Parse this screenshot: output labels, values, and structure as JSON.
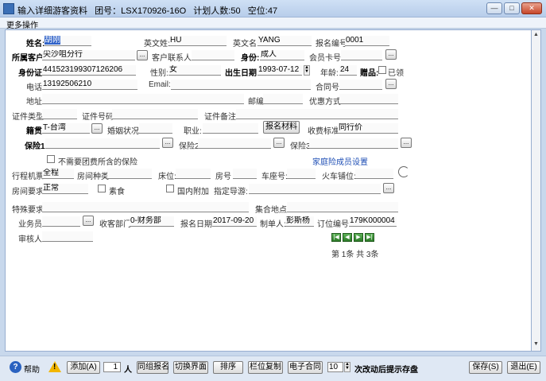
{
  "window": {
    "title": "输入详细游客资料",
    "group_label": "团号：",
    "group_no": "LSX170926-16O",
    "plan_label": "计划人数:",
    "plan_count": "50",
    "vacancy_label": "空位:",
    "vacancy_count": "47"
  },
  "menu": {
    "more_ops": "更多操作"
  },
  "form": {
    "name_label": "姓名:",
    "name_value": "胡刚",
    "en_surname_label": "英文姓:",
    "en_surname_value": "HU",
    "en_name_label": "英文名:",
    "en_name_value": "YANG",
    "reg_no_label": "报名编号:",
    "reg_no_value": "0001",
    "customer_label": "所属客户:",
    "customer_value": "尖沙咀分行",
    "contact_label": "客户联系人:",
    "contact_value": "",
    "identity_label": "身份:",
    "identity_value": "成人",
    "member_card_label": "会员卡号:",
    "member_card_value": "",
    "id_card_label": "身份证:",
    "id_card_value": "441523199307126206",
    "gender_label": "性别:",
    "gender_value": "女",
    "birth_label": "出生日期:",
    "birth_value": "1993-07-12",
    "age_label": "年龄:",
    "age_value": "24",
    "gift_label": "赠品:",
    "gift_checked_label": "已领",
    "phone_label": "电话:",
    "phone_value": "13192506210",
    "email_label": "Email:",
    "email_value": "",
    "contract_no_label": "合同号:",
    "contract_no_value": "",
    "address_label": "地址:",
    "address_value": "",
    "postcode_label": "邮编:",
    "postcode_value": "",
    "discount_label": "优惠方式:",
    "discount_value": "",
    "cert_type_label": "证件类型:",
    "cert_type_value": "",
    "cert_no_label": "证件号码:",
    "cert_no_value": "",
    "cert_note_label": "证件备注:",
    "cert_note_value": "",
    "origin_label": "籍贯:",
    "origin_value": "T-台湾",
    "marital_label": "婚姻状况:",
    "marital_value": "",
    "job_label": "职业:",
    "job_value": "",
    "reg_material_button": "报名材料",
    "fee_std_label": "收费标准:",
    "fee_std_value": "同行价",
    "insurance1_label": "保险1:",
    "insurance1_value": "",
    "insurance2_label": "保险2:",
    "insurance2_value": "",
    "insurance3_label": "保险3:",
    "insurance3_value": "",
    "no_group_insurance_label": "不需要团费所含的保险",
    "family_insurance_link": "家庭险成员设置",
    "ticket_label": "行程机票:",
    "ticket_value": "全程",
    "room_type_label": "房间种类:",
    "room_type_value": "",
    "bed_label": "床位:",
    "bed_value": "",
    "room_no_label": "房号",
    "room_no_value": "",
    "seat_no_label": "车座号:",
    "seat_no_value": "",
    "train_bed_label": "火车铺位:",
    "train_bed_value": "",
    "room_req_label": "房间要求:",
    "room_req_value": "正常",
    "vegetarian_label": "素食",
    "domestic_add_label": "国内附加",
    "guide_label": "指定导游:",
    "guide_value": "",
    "special_req_label": "特殊要求:",
    "special_req_value": "",
    "meeting_label": "集合地点:",
    "meeting_value": "",
    "salesman_label": "业务员:",
    "salesman_value": "",
    "recv_dept_label": "收客部门:",
    "recv_dept_value": "0-财务部",
    "reg_date_label": "报名日期:",
    "reg_date_value": "2017-09-20",
    "maker_label": "制单人:",
    "maker_value": "彭斯杨",
    "order_no_label": "订位编号:",
    "order_no_value": "179K000004",
    "auditor_label": "审核人:",
    "auditor_value": ""
  },
  "pager": {
    "text": "第 1条 共 3条"
  },
  "toolbar": {
    "help_label": "帮助",
    "add_label": "添加(A)",
    "count_value": "1",
    "person_unit": "人",
    "same_group_label": "同组报名",
    "switch_label": "切换界面",
    "sort_label": "排序",
    "copy_col_label": "栏位复制",
    "e_contract_label": "电子合同",
    "autosave_value": "10",
    "autosave_label": "次改动后提示存盘",
    "save_label": "保存(S)",
    "exit_label": "退出(E)"
  },
  "icons": {
    "help": "help-icon",
    "warning": "warning-icon",
    "ellipsis": "ellipsis-icon",
    "first": "first-page-icon",
    "prev": "prev-page-icon",
    "next": "next-page-icon",
    "last": "last-page-icon",
    "refresh": "refresh-icon"
  }
}
